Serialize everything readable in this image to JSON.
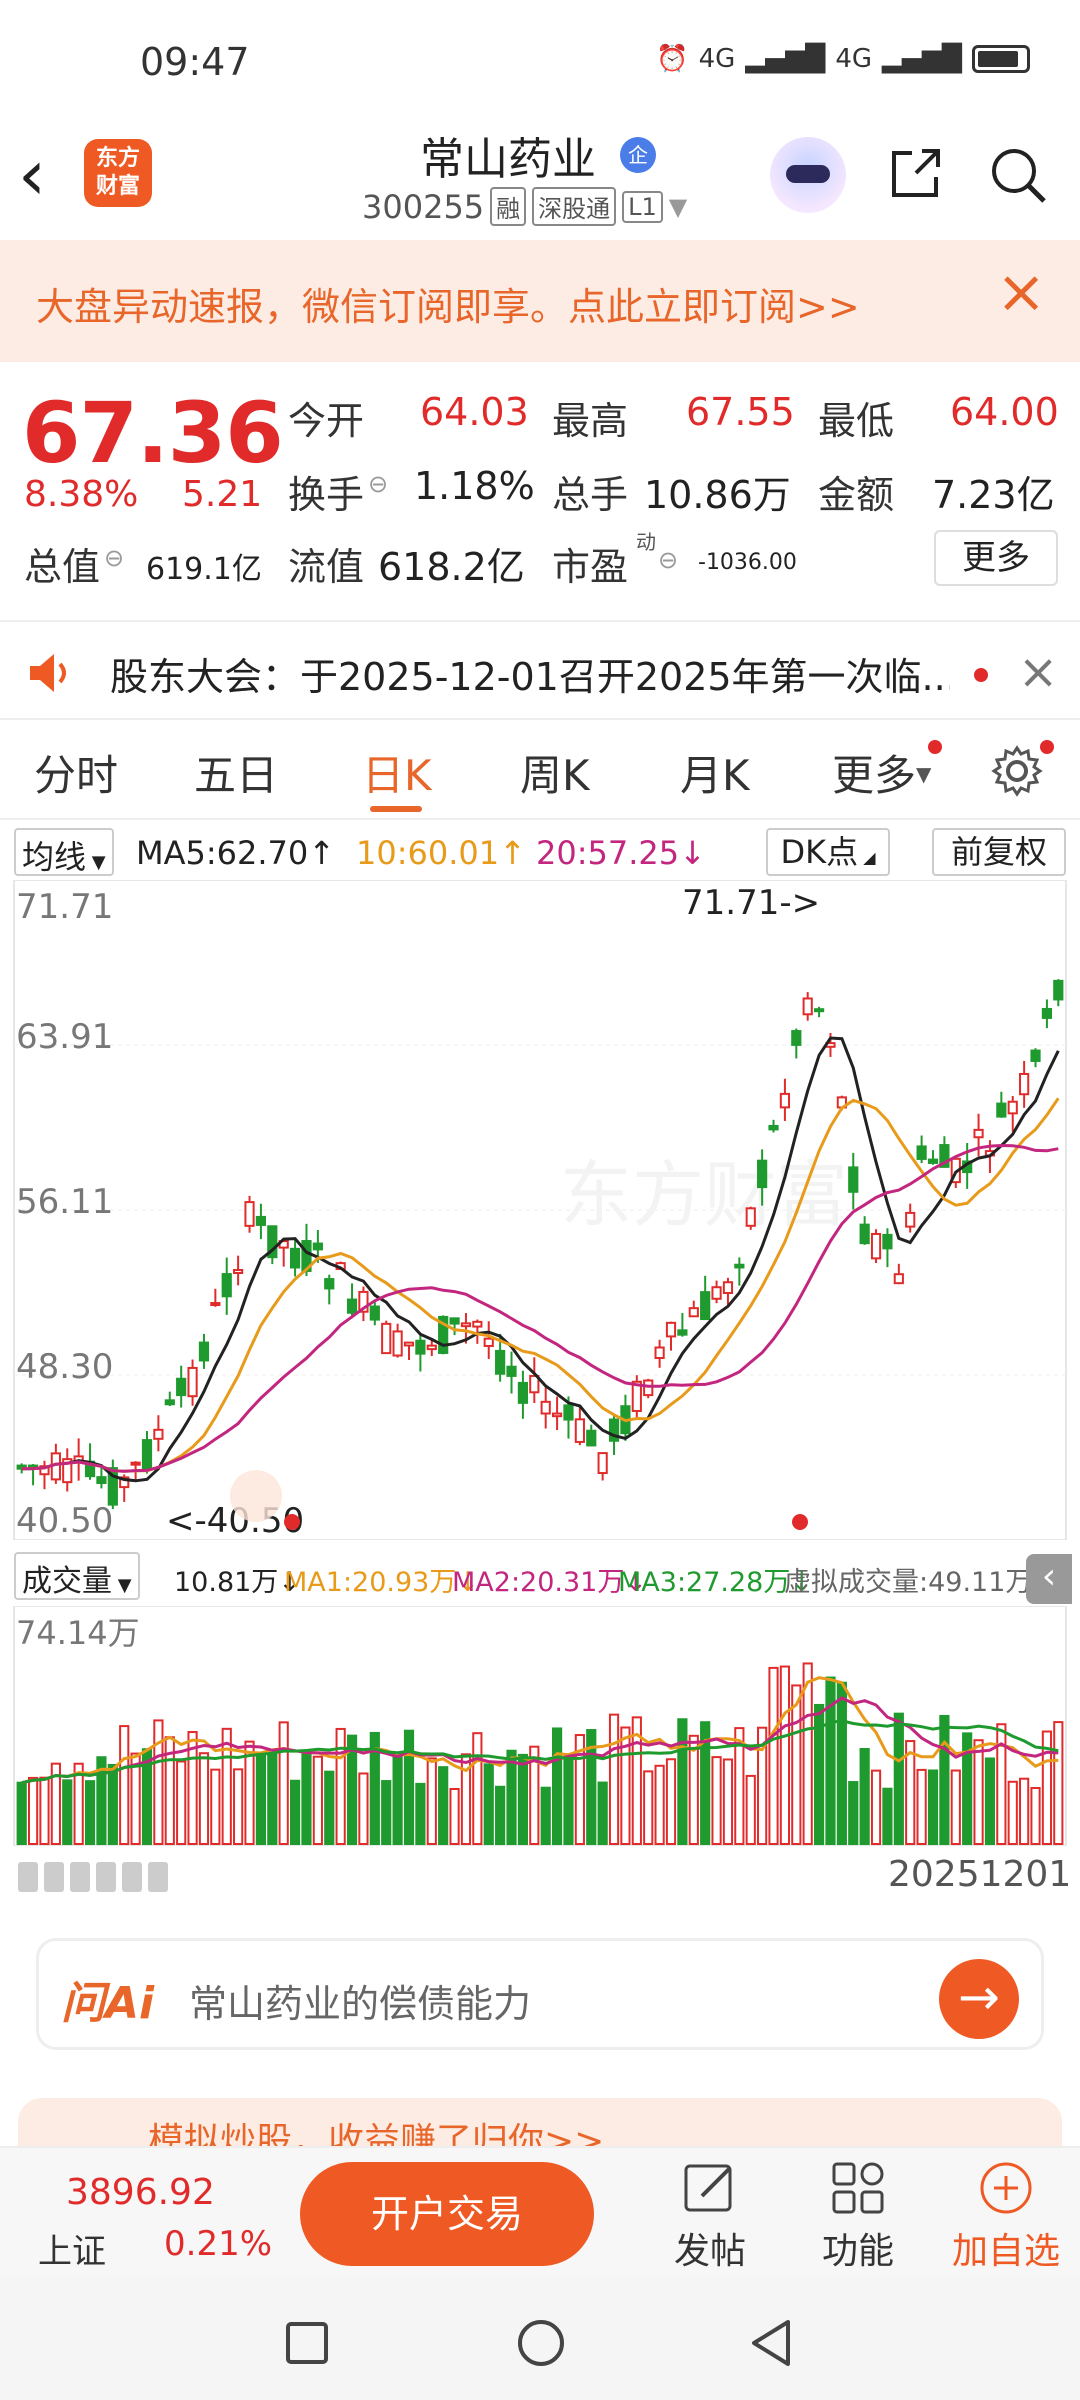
{
  "status_bar": {
    "time": "09:47",
    "network1": "4G",
    "network2": "4G"
  },
  "header": {
    "logo_line1": "东方",
    "logo_line2": "财富",
    "stock_name": "常山药业",
    "badge": "企",
    "stock_code": "300255",
    "tag1": "融",
    "tag2": "深股通",
    "tag3": "L1"
  },
  "banner": {
    "text": "大盘异动速报，微信订阅即享。点此立即订阅>>"
  },
  "quote": {
    "price": "67.36",
    "change_pct": "8.38%",
    "change": "5.21",
    "open_label": "今开",
    "open": "64.03",
    "high_label": "最高",
    "high": "67.55",
    "low_label": "最低",
    "low": "64.00",
    "turnover_label": "换手",
    "turnover": "1.18%",
    "volume_label": "总手",
    "volume": "10.86万",
    "amount_label": "金额",
    "amount": "7.23亿",
    "mktcap_label": "总值",
    "mktcap": "619.1亿",
    "float_label": "流值",
    "float_cap": "618.2亿",
    "pe_label": "市盈",
    "pe_super": "动",
    "pe": "-1036.00",
    "more": "更多"
  },
  "notice": {
    "text": "股东大会：于2025-12-01召开2025年第一次临..."
  },
  "tabs": [
    {
      "label": "分时"
    },
    {
      "label": "五日"
    },
    {
      "label": "日K"
    },
    {
      "label": "周K"
    },
    {
      "label": "月K"
    },
    {
      "label": "更多"
    }
  ],
  "ma_bar": {
    "selector": "均线",
    "ma5": "MA5:62.70↑",
    "ma10": "10:60.01↑",
    "ma20": "20:57.25↓",
    "dk": "DK点",
    "adjust": "前复权",
    "colors": {
      "ma5": "#222222",
      "ma10": "#e89a1a",
      "ma20": "#c2267e"
    }
  },
  "kline": {
    "y_labels": [
      "71.71",
      "63.91",
      "56.11",
      "48.30",
      "40.50"
    ],
    "max_marker": "71.71->",
    "min_marker": "<-40.50",
    "watermark": "东方财富"
  },
  "vol_bar": {
    "selector": "成交量",
    "vol": "10.81万↓",
    "ma1": "MA1:20.93万↓",
    "ma2": "MA2:20.31万↓",
    "ma3": "MA3:27.28万↓",
    "virtual": "虚拟成交量:49.11万",
    "colors": {
      "ma1": "#e89a1a",
      "ma2": "#c2267e",
      "ma3": "#1f9a2e"
    }
  },
  "volume_chart": {
    "y_label": "74.14万",
    "date": "20251201"
  },
  "ask_ai": {
    "logo": "问Ai",
    "placeholder": "常山药业的偿债能力"
  },
  "promo": {
    "text": "模拟炒股，收益赚了归你>>"
  },
  "bottom_bar": {
    "index_value": "3896.92",
    "index_name": "上证",
    "index_pct": "0.21%",
    "trade": "开户交易",
    "post": "发帖",
    "func": "功能",
    "add": "加自选"
  },
  "colors": {
    "up": "#e12b2b",
    "down": "#1f9a2e",
    "accent": "#ef5a24"
  }
}
